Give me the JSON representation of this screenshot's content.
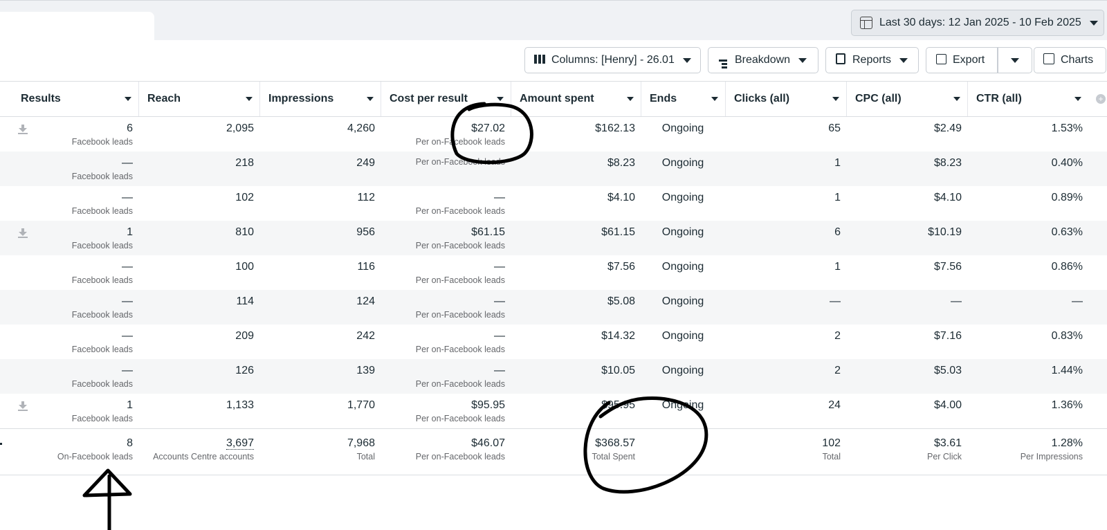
{
  "date_range": {
    "label": "Last 30 days: 12 Jan 2025 - 10 Feb 2025"
  },
  "toolbar": {
    "columns_label": "Columns: [Henry] - 26.01",
    "breakdown_label": "Breakdown",
    "reports_label": "Reports",
    "export_label": "Export",
    "charts_label": "Charts"
  },
  "columns": [
    "Results",
    "Reach",
    "Impressions",
    "Cost per result",
    "Amount spent",
    "Ends",
    "Clicks (all)",
    "CPC (all)",
    "CTR (all)"
  ],
  "rows": [
    {
      "results": "6",
      "results_sub": "Facebook leads",
      "reach": "2,095",
      "impressions": "4,260",
      "cpr": "$27.02",
      "cpr_sub": "Per on-Facebook leads",
      "spent": "$162.13",
      "ends": "Ongoing",
      "clicks": "65",
      "cpc": "$2.49",
      "ctr": "1.53%"
    },
    {
      "results": "—",
      "results_sub": "Facebook leads",
      "reach": "218",
      "impressions": "249",
      "cpr": "",
      "cpr_sub": "Per on-Facebook leads",
      "spent": "$8.23",
      "ends": "Ongoing",
      "clicks": "1",
      "cpc": "$8.23",
      "ctr": "0.40%"
    },
    {
      "results": "—",
      "results_sub": "Facebook leads",
      "reach": "102",
      "impressions": "112",
      "cpr": "—",
      "cpr_sub": "Per on-Facebook leads",
      "spent": "$4.10",
      "ends": "Ongoing",
      "clicks": "1",
      "cpc": "$4.10",
      "ctr": "0.89%"
    },
    {
      "results": "1",
      "results_sub": "Facebook leads",
      "reach": "810",
      "impressions": "956",
      "cpr": "$61.15",
      "cpr_sub": "Per on-Facebook leads",
      "spent": "$61.15",
      "ends": "Ongoing",
      "clicks": "6",
      "cpc": "$10.19",
      "ctr": "0.63%"
    },
    {
      "results": "—",
      "results_sub": "Facebook leads",
      "reach": "100",
      "impressions": "116",
      "cpr": "—",
      "cpr_sub": "Per on-Facebook leads",
      "spent": "$7.56",
      "ends": "Ongoing",
      "clicks": "1",
      "cpc": "$7.56",
      "ctr": "0.86%"
    },
    {
      "results": "—",
      "results_sub": "Facebook leads",
      "reach": "114",
      "impressions": "124",
      "cpr": "—",
      "cpr_sub": "Per on-Facebook leads",
      "spent": "$5.08",
      "ends": "Ongoing",
      "clicks": "—",
      "cpc": "—",
      "ctr": "—"
    },
    {
      "results": "—",
      "results_sub": "Facebook leads",
      "reach": "209",
      "impressions": "242",
      "cpr": "—",
      "cpr_sub": "Per on-Facebook leads",
      "spent": "$14.32",
      "ends": "Ongoing",
      "clicks": "2",
      "cpc": "$7.16",
      "ctr": "0.83%"
    },
    {
      "results": "—",
      "results_sub": "Facebook leads",
      "reach": "126",
      "impressions": "139",
      "cpr": "—",
      "cpr_sub": "Per on-Facebook leads",
      "spent": "$10.05",
      "ends": "Ongoing",
      "clicks": "2",
      "cpc": "$5.03",
      "ctr": "1.44%"
    },
    {
      "results": "1",
      "results_sub": "Facebook leads",
      "reach": "1,133",
      "impressions": "1,770",
      "cpr": "$95.95",
      "cpr_sub": "Per on-Facebook leads",
      "spent": "$95.95",
      "ends": "Ongoing",
      "clicks": "24",
      "cpc": "$4.00",
      "ctr": "1.36%"
    }
  ],
  "totals": {
    "results": "8",
    "results_sub": "On-Facebook leads",
    "reach": "3,697",
    "reach_sub": "Accounts Centre accounts",
    "impressions": "7,968",
    "impressions_sub": "Total",
    "cpr": "$46.07",
    "cpr_sub": "Per on-Facebook leads",
    "spent": "$368.57",
    "spent_sub": "Total Spent",
    "clicks": "102",
    "clicks_sub": "Total",
    "cpc": "$3.61",
    "cpc_sub": "Per Click",
    "ctr": "1.28%",
    "ctr_sub": "Per Impressions"
  },
  "download_rows": [
    0,
    3,
    8
  ],
  "colors": {
    "annotation": "#000000",
    "alt_row": "#f5f6f7",
    "topbar": "#f0f2f5"
  }
}
